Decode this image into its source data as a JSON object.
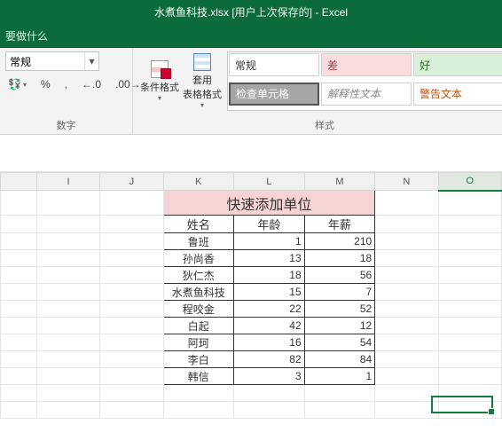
{
  "title": {
    "file": "水煮鱼科技.xlsx",
    "mode": "[用户上次保存的]",
    "dash": " - ",
    "app": "Excel"
  },
  "tell_me": "要做什么",
  "ribbon": {
    "number": {
      "format_value": "常规",
      "group_label": "数字",
      "percent": "%",
      "comma": ",",
      "inc_dec_left": ".0",
      "inc_dec_right": ".00"
    },
    "styles": {
      "cond_format": "条件格式",
      "table_format": "套用\n表格格式",
      "group_label": "样式",
      "gallery": {
        "normal": "常规",
        "bad": "差",
        "good": "好",
        "check": "检查单元格",
        "explain": "解释性文本",
        "warn": "警告文本"
      }
    }
  },
  "columns": [
    "I",
    "J",
    "K",
    "L",
    "M",
    "N",
    "O"
  ],
  "selected_column": "O",
  "table": {
    "title": "快速添加单位",
    "headers": [
      "姓名",
      "年龄",
      "年薪"
    ],
    "rows": [
      {
        "name": "鲁班",
        "age": "1",
        "salary": "210"
      },
      {
        "name": "孙尚香",
        "age": "13",
        "salary": "18"
      },
      {
        "name": "狄仁杰",
        "age": "18",
        "salary": "56"
      },
      {
        "name": "水煮鱼科技",
        "age": "15",
        "salary": "7"
      },
      {
        "name": "程咬金",
        "age": "22",
        "salary": "52"
      },
      {
        "name": "白起",
        "age": "42",
        "salary": "12"
      },
      {
        "name": "阿珂",
        "age": "16",
        "salary": "54"
      },
      {
        "name": "李白",
        "age": "82",
        "salary": "84"
      },
      {
        "name": "韩信",
        "age": "3",
        "salary": "1"
      }
    ]
  },
  "chart_data": {
    "type": "table",
    "title": "快速添加单位",
    "columns": [
      "姓名",
      "年龄",
      "年薪"
    ],
    "rows": [
      [
        "鲁班",
        1,
        210
      ],
      [
        "孙尚香",
        13,
        18
      ],
      [
        "狄仁杰",
        18,
        56
      ],
      [
        "水煮鱼科技",
        15,
        7
      ],
      [
        "程咬金",
        22,
        52
      ],
      [
        "白起",
        42,
        12
      ],
      [
        "阿珂",
        16,
        54
      ],
      [
        "李白",
        82,
        84
      ],
      [
        "韩信",
        3,
        1
      ]
    ]
  }
}
